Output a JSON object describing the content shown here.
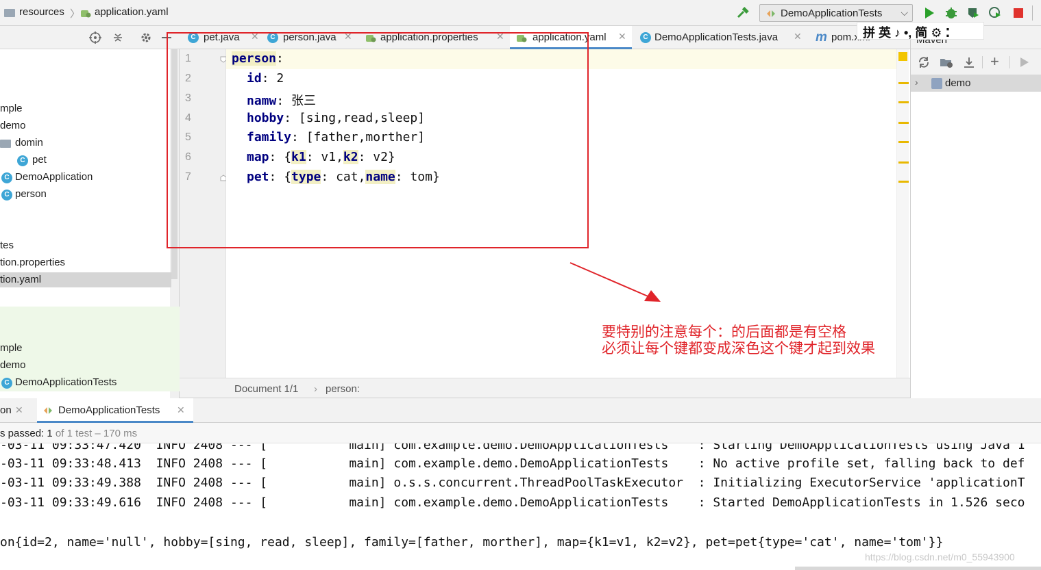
{
  "breadcrumb": {
    "folder": "resources",
    "file": "application.yaml"
  },
  "run_config": {
    "label": "DemoApplicationTests"
  },
  "project_tree": [
    {
      "label": "mple"
    },
    {
      "label": "demo"
    },
    {
      "label": "domin"
    },
    {
      "label": "pet"
    },
    {
      "label": "DemoApplication"
    },
    {
      "label": "person"
    },
    {
      "label": "tes"
    },
    {
      "label": "tion.properties"
    },
    {
      "label": "tion.yaml"
    },
    {
      "label": "mple"
    },
    {
      "label": "demo"
    },
    {
      "label": "DemoApplicationTests"
    }
  ],
  "editor_tabs": [
    {
      "label": "pet.java"
    },
    {
      "label": "person.java"
    },
    {
      "label": "application.properties"
    },
    {
      "label": "application.yaml"
    },
    {
      "label": "DemoApplicationTests.java"
    },
    {
      "label": "pom.xml"
    }
  ],
  "ime": {
    "text": "拼 英 ♪ •, 简 ⚙ ⁚"
  },
  "maven": {
    "header": "Maven",
    "root": "demo"
  },
  "editor": {
    "line_numbers": [
      "1",
      "2",
      "3",
      "4",
      "5",
      "6",
      "7"
    ],
    "code": {
      "l1_key": "person",
      "l1_rest": ":",
      "l2_key": "id",
      "l2_rest": ": 2",
      "l3_key": "namw",
      "l3_rest": ": 张三",
      "l4_key": "hobby",
      "l4_rest": ": [sing,read,sleep]",
      "l5_key": "family",
      "l5_rest": ": [father,morther]",
      "l6_key": "map",
      "l6_a": ": {",
      "l6_k1": "k1",
      "l6_b": ": v1,",
      "l6_k2": "k2",
      "l6_c": ": v2}",
      "l7_key": "pet",
      "l7_a": ": {",
      "l7_k1": "type",
      "l7_b": ": cat,",
      "l7_k2": "name",
      "l7_c": ": tom}"
    }
  },
  "editor_breadcrumb": {
    "doc": "Document 1/1",
    "sep": "›",
    "path": "person:"
  },
  "annotation": {
    "line1": "要特别的注意每个：的后面都是有空格",
    "line2": "必须让每个键都变成深色这个键才起到效果"
  },
  "run_tabs": [
    {
      "label": "on"
    },
    {
      "label": "DemoApplicationTests"
    }
  ],
  "run_status": {
    "prefix": "s passed: ",
    "count": "1",
    "rest": " of 1 test – 170 ms"
  },
  "console": [
    "-03-11 09:33:48.413  INFO 2408 --- [           main] com.example.demo.DemoApplicationTests    : No active profile set, falling back to def",
    "-03-11 09:33:49.388  INFO 2408 --- [           main] o.s.s.concurrent.ThreadPoolTaskExecutor  : Initializing ExecutorService 'applicationT",
    "-03-11 09:33:49.616  INFO 2408 --- [           main] com.example.demo.DemoApplicationTests    : Started DemoApplicationTests in 1.526 seco",
    "",
    "on{id=2, name='null', hobby=[sing, read, sleep], family=[father, morther], map={k1=v1, k2=v2}, pet=pet{type='cat', name='tom'}}"
  ],
  "watermark": "https://blog.csdn.net/m0_55943900",
  "colors": {
    "accent": "#4a88c7",
    "annotation": "#e0242a",
    "key": "#000080",
    "run": "#2aa02a"
  }
}
